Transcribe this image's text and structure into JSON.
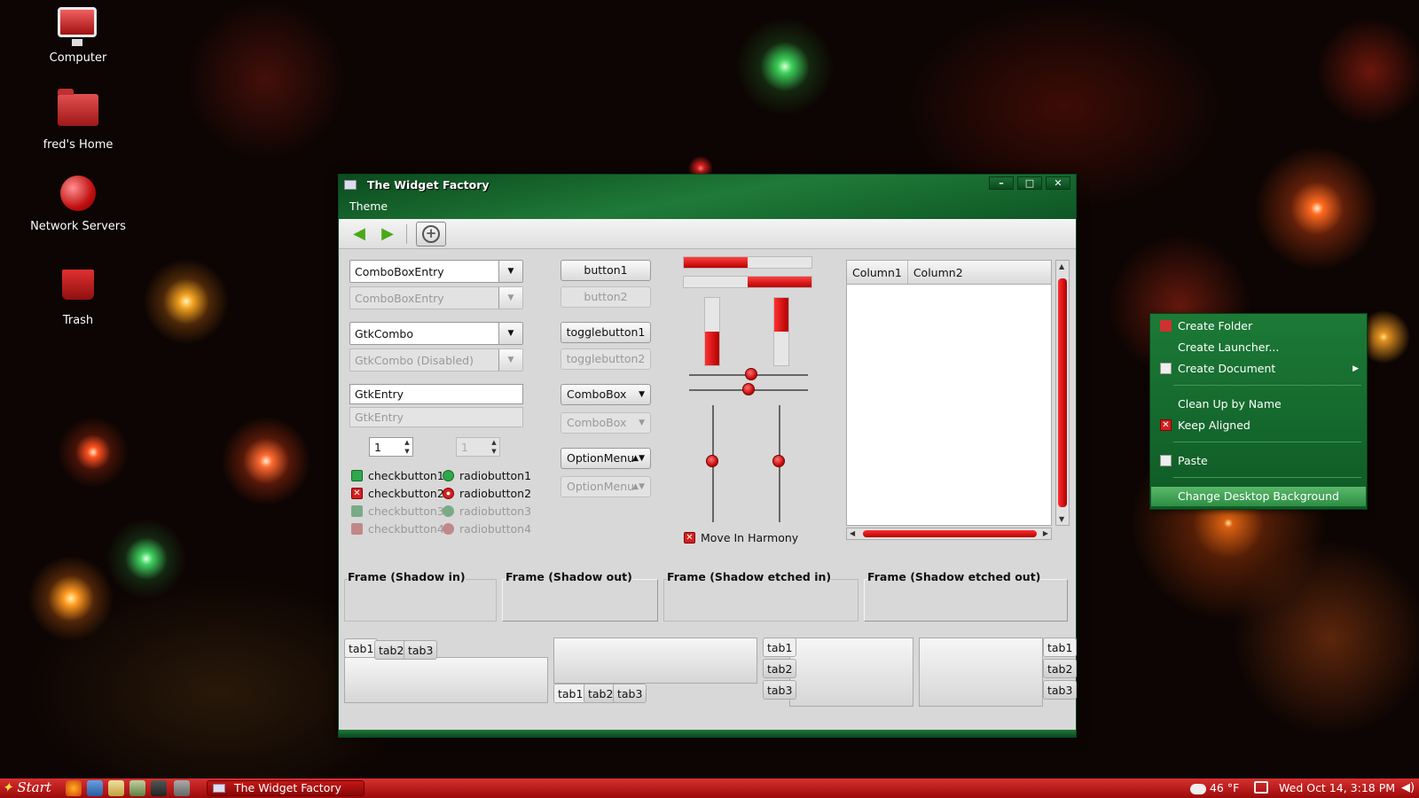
{
  "desktop": {
    "icons": [
      {
        "label": "Computer"
      },
      {
        "label": "fred's Home"
      },
      {
        "label": "Network Servers"
      },
      {
        "label": "Trash"
      }
    ]
  },
  "window": {
    "title": "The Widget Factory",
    "menu": "Theme",
    "combos": {
      "entry1": "ComboBoxEntry",
      "entry2": "ComboBoxEntry",
      "gtk1": "GtkCombo",
      "gtk2": "GtkCombo (Disabled)"
    },
    "entries": {
      "e1": "GtkEntry",
      "e2": "GtkEntry"
    },
    "spins": {
      "s1": "1",
      "s2": "1"
    },
    "checks": [
      "checkbutton1",
      "checkbutton2",
      "checkbutton3",
      "checkbutton4"
    ],
    "radios": [
      "radiobutton1",
      "radiobutton2",
      "radiobutton3",
      "radiobutton4"
    ],
    "buttons": {
      "b1": "button1",
      "b2": "button2",
      "t1": "togglebutton1",
      "t2": "togglebutton2",
      "c1": "ComboBox",
      "c2": "ComboBox",
      "o1": "OptionMenu",
      "o2": "OptionMenu"
    },
    "progress": {
      "h1": 0.5,
      "h2": 0.5,
      "v1": 0.5,
      "v2": 0.5
    },
    "scales": {
      "h1": 0.52,
      "h2": 0.5,
      "v1": 0.48,
      "v2": 0.48
    },
    "harmony": "Move In Harmony",
    "tree": {
      "columns": [
        "Column1",
        "Column2"
      ]
    },
    "frames": [
      "Frame (Shadow in)",
      "Frame (Shadow out)",
      "Frame (Shadow etched in)",
      "Frame (Shadow etched out)"
    ],
    "tabs": [
      "tab1",
      "tab2",
      "tab3"
    ]
  },
  "context_menu": {
    "items": [
      "Create Folder",
      "Create Launcher...",
      "Create Document",
      "Clean Up by Name",
      "Keep Aligned",
      "Paste",
      "Change Desktop Background"
    ]
  },
  "taskbar": {
    "start": "Start",
    "task": "The Widget Factory",
    "weather": "46 °F",
    "clock": "Wed Oct 14,  3:18 PM"
  },
  "colors": {
    "accent_red": "#c00000",
    "title_green": "#1f7a38"
  }
}
